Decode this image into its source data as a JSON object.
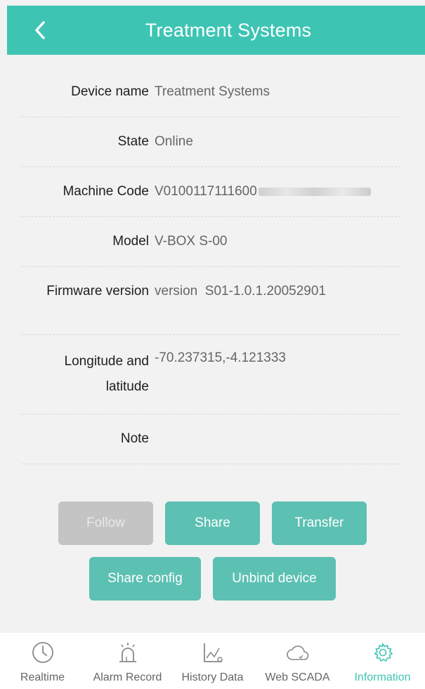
{
  "header": {
    "title": "Treatment Systems",
    "back_icon": "chevron-left-icon"
  },
  "details": [
    {
      "label": "Device name",
      "value": "Treatment Systems"
    },
    {
      "label": "State",
      "value": "Online"
    },
    {
      "label": "Machine Code",
      "value": "V0100117111600"
    },
    {
      "label": "Model",
      "value": "V-BOX S-00"
    },
    {
      "label": "Firmware version",
      "value": "version  S01-1.0.1.20052901"
    },
    {
      "label": "Longitude and latitude",
      "value": "-70.237315,-4.121333"
    },
    {
      "label": "Note",
      "value": ""
    }
  ],
  "buttons": {
    "follow": "Follow",
    "share": "Share",
    "transfer": "Transfer",
    "share_config": "Share config",
    "unbind": "Unbind device"
  },
  "tabs": [
    {
      "label": "Realtime",
      "icon": "clock-icon"
    },
    {
      "label": "Alarm Record",
      "icon": "alarm-icon"
    },
    {
      "label": "History Data",
      "icon": "chart-icon"
    },
    {
      "label": "Web SCADA",
      "icon": "cloud-icon"
    },
    {
      "label": "Information",
      "icon": "gear-icon"
    }
  ],
  "colors": {
    "accent": "#3ec4b3",
    "button": "#5cc0b2",
    "disabled": "#c4c4c4"
  }
}
